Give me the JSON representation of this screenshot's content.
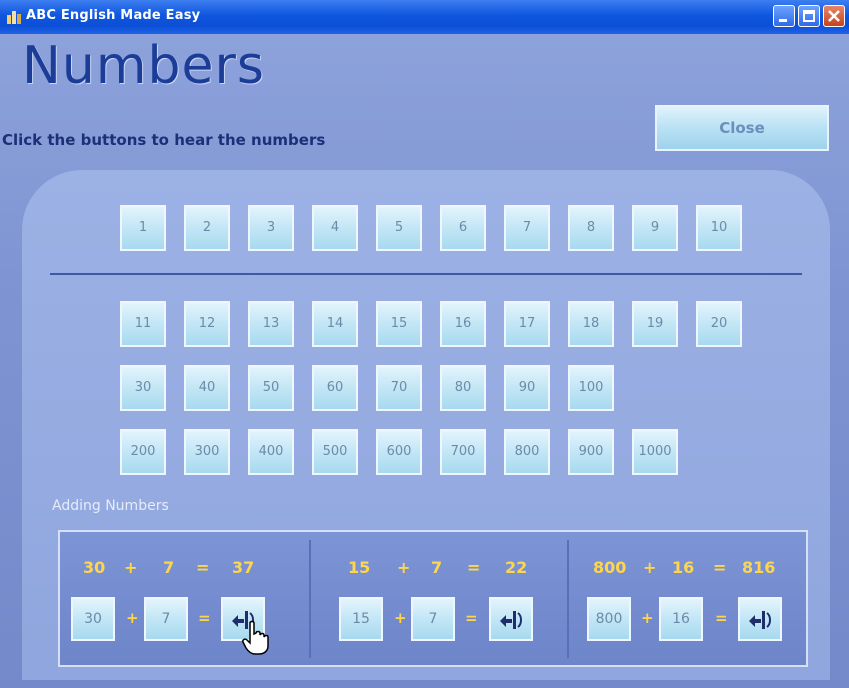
{
  "window": {
    "title": "ABC English Made Easy"
  },
  "page": {
    "title": "Numbers",
    "subtitle": "Click the buttons to hear the numbers",
    "close_label": "Close"
  },
  "rows": {
    "ones": [
      "1",
      "2",
      "3",
      "4",
      "5",
      "6",
      "7",
      "8",
      "9",
      "10"
    ],
    "teens": [
      "11",
      "12",
      "13",
      "14",
      "15",
      "16",
      "17",
      "18",
      "19",
      "20"
    ],
    "tens": [
      "30",
      "40",
      "50",
      "60",
      "70",
      "80",
      "90",
      "100"
    ],
    "hundreds": [
      "200",
      "300",
      "400",
      "500",
      "600",
      "700",
      "800",
      "900",
      "1000"
    ]
  },
  "adding": {
    "label": "Adding Numbers",
    "examples": [
      {
        "a": "30",
        "op": "+",
        "b": "7",
        "eq": "=",
        "result": "37"
      },
      {
        "a": "15",
        "op": "+",
        "b": "7",
        "eq": "=",
        "result": "22"
      },
      {
        "a": "800",
        "op": "+",
        "b": "16",
        "eq": "=",
        "result": "816"
      }
    ]
  },
  "icons": {
    "app": "abc-app-icon",
    "speaker": "hear-hand-icon",
    "cursor": "hand-pointer-icon"
  },
  "colors": {
    "title": "#1c3d97",
    "accent": "#ffd54a",
    "titlebar": "#0f56df"
  }
}
